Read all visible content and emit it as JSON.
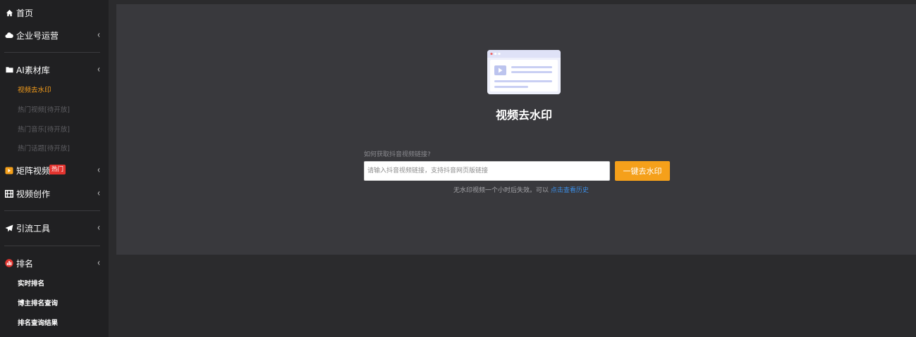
{
  "sidebar": {
    "home": {
      "label": "首页",
      "icon": "home-icon"
    },
    "enterprise": {
      "label": "企业号运营",
      "icon": "cloud-icon"
    },
    "ai_library": {
      "label": "AI素材库",
      "icon": "folder-icon",
      "items": [
        {
          "label": "视频去水印",
          "state": "active"
        },
        {
          "label": "热门视频[待开放]",
          "state": "disabled"
        },
        {
          "label": "热门音乐[待开放]",
          "state": "disabled"
        },
        {
          "label": "热门话题[待开放]",
          "state": "disabled"
        }
      ]
    },
    "matrix_video": {
      "label": "矩阵视频",
      "badge": "热门",
      "icon": "video-badge-icon"
    },
    "video_create": {
      "label": "视频创作",
      "icon": "film-icon"
    },
    "traffic_tools": {
      "label": "引流工具",
      "icon": "paper-plane-icon"
    },
    "ranking": {
      "label": "排名",
      "icon": "ranking-icon",
      "items": [
        {
          "label": "实时排名"
        },
        {
          "label": "博主排名查询"
        },
        {
          "label": "排名查询结果"
        }
      ]
    },
    "chevron": "‹"
  },
  "main": {
    "title": "视频去水印",
    "help_link": "如何获取抖音视频链接?",
    "input_placeholder": "请输入抖音视频链接，支持抖音网页版链接",
    "button_label": "一键去水印",
    "note_prefix": "无水印视频一个小时后失效。可以",
    "note_link": "点击查看历史"
  },
  "colors": {
    "accent": "#f5a01a",
    "active_menu": "#f29b1b",
    "hot_badge": "#e3342f",
    "link": "#3b8ee6",
    "sidebar_bg": "#202022",
    "panel_bg": "#39393d",
    "page_bg": "#2b2b2d"
  }
}
